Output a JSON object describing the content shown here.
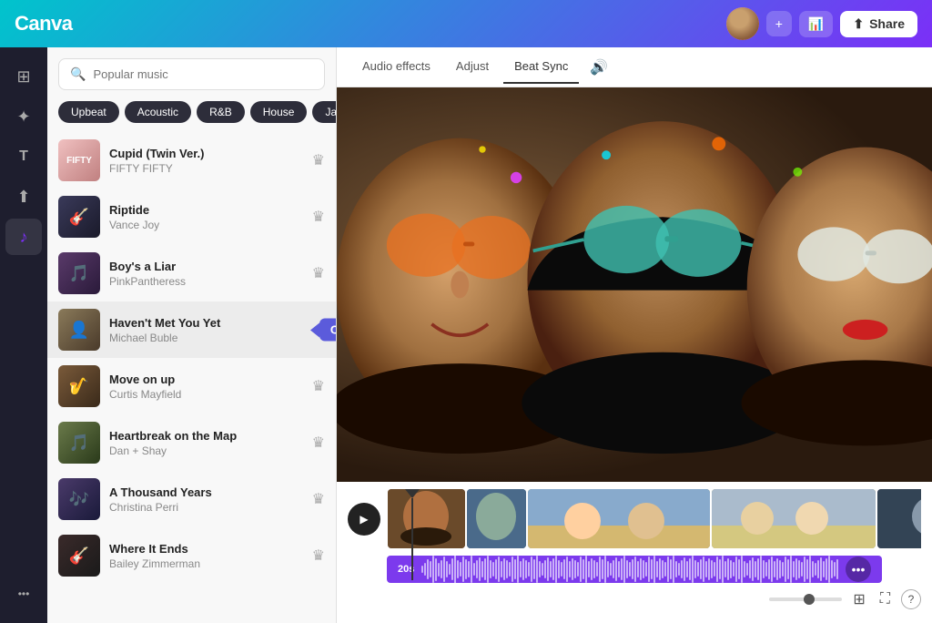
{
  "app": {
    "title": "Canva",
    "logo_text": "Canva"
  },
  "navbar": {
    "add_btn": "+",
    "analytics_icon": "chart",
    "share_btn": "Share",
    "share_icon": "↑"
  },
  "sidebar_icons": [
    {
      "name": "grid-icon",
      "symbol": "⊞",
      "active": false
    },
    {
      "name": "elements-icon",
      "symbol": "✦",
      "active": false
    },
    {
      "name": "text-icon",
      "symbol": "T",
      "active": false
    },
    {
      "name": "upload-icon",
      "symbol": "↑",
      "active": false
    },
    {
      "name": "music-icon",
      "symbol": "♪",
      "active": true
    },
    {
      "name": "more-icon",
      "symbol": "•••",
      "active": false
    }
  ],
  "music_panel": {
    "search_placeholder": "Popular music",
    "genre_tags": [
      {
        "label": "Upbeat",
        "active": false
      },
      {
        "label": "Acoustic",
        "active": false
      },
      {
        "label": "R&B",
        "active": false
      },
      {
        "label": "House",
        "active": false
      },
      {
        "label": "Jazz",
        "active": false
      },
      {
        "label": "›",
        "active": false
      }
    ],
    "tracks": [
      {
        "id": 1,
        "title": "Cupid (Twin Ver.)",
        "artist": "FIFTY FIFTY",
        "thumb_color": "#e8a0a0",
        "thumb_emoji": "🎵"
      },
      {
        "id": 2,
        "title": "Riptide",
        "artist": "Vance Joy",
        "thumb_color": "#2a2a3a",
        "thumb_emoji": "🎶"
      },
      {
        "id": 3,
        "title": "Boy's a Liar",
        "artist": "PinkPantheress",
        "thumb_color": "#3a3a4a",
        "thumb_emoji": "🎵"
      },
      {
        "id": 4,
        "title": "Haven't Met You Yet",
        "artist": "Michael Buble",
        "thumb_color": "#4a4a3a",
        "thumb_emoji": "👤",
        "highlighted": true,
        "tooltip": "Charlie"
      },
      {
        "id": 5,
        "title": "Move on up",
        "artist": "Curtis Mayfield",
        "thumb_color": "#5a3a2a",
        "thumb_emoji": "🎸"
      },
      {
        "id": 6,
        "title": "Heartbreak on the Map",
        "artist": "Dan + Shay",
        "thumb_color": "#4a5a2a",
        "thumb_emoji": "🎵"
      },
      {
        "id": 7,
        "title": "A Thousand Years",
        "artist": "Christina Perri",
        "thumb_color": "#3a2a5a",
        "thumb_emoji": "🎶"
      },
      {
        "id": 8,
        "title": "Where It Ends",
        "artist": "Bailey Zimmerman",
        "thumb_color": "#2a2a2a",
        "thumb_emoji": "🎵"
      }
    ]
  },
  "tabs": [
    {
      "label": "Audio effects",
      "active": false
    },
    {
      "label": "Adjust",
      "active": false
    },
    {
      "label": "Beat Sync",
      "active": true
    }
  ],
  "timeline": {
    "audio_label": "20s",
    "play_icon": "▶"
  },
  "bottom_toolbar": {
    "fullscreen_icon": "⛶",
    "help_icon": "?"
  }
}
